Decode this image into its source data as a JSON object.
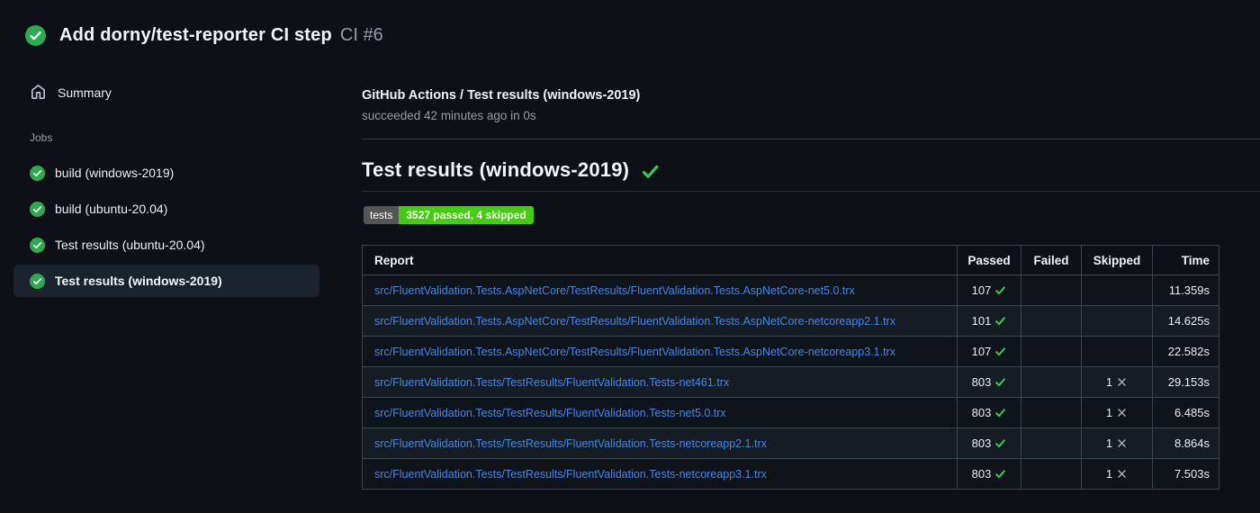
{
  "header": {
    "title": "Add dorny/test-reporter CI step",
    "run_number": "CI #6",
    "status": "success"
  },
  "sidebar": {
    "summary_label": "Summary",
    "jobs_label": "Jobs",
    "jobs": [
      {
        "label": "build (windows-2019)",
        "status": "success",
        "selected": false
      },
      {
        "label": "build (ubuntu-20.04)",
        "status": "success",
        "selected": false
      },
      {
        "label": "Test results (ubuntu-20.04)",
        "status": "success",
        "selected": false
      },
      {
        "label": "Test results (windows-2019)",
        "status": "success",
        "selected": true
      }
    ]
  },
  "main": {
    "breadcrumb": "GitHub Actions / Test results (windows-2019)",
    "status_line": "succeeded 42 minutes ago in 0s",
    "section_title": "Test results (windows-2019)",
    "badge": {
      "label": "tests",
      "value": "3527 passed, 4 skipped",
      "label_bg": "#555555",
      "value_bg": "#44cc11"
    },
    "table": {
      "columns": [
        "Report",
        "Passed",
        "Failed",
        "Skipped",
        "Time"
      ],
      "rows": [
        {
          "report": "src/FluentValidation.Tests.AspNetCore/TestResults/FluentValidation.Tests.AspNetCore-net5.0.trx",
          "passed": "107",
          "failed": "",
          "skipped": "",
          "time": "11.359s"
        },
        {
          "report": "src/FluentValidation.Tests.AspNetCore/TestResults/FluentValidation.Tests.AspNetCore-netcoreapp2.1.trx",
          "passed": "101",
          "failed": "",
          "skipped": "",
          "time": "14.625s"
        },
        {
          "report": "src/FluentValidation.Tests.AspNetCore/TestResults/FluentValidation.Tests.AspNetCore-netcoreapp3.1.trx",
          "passed": "107",
          "failed": "",
          "skipped": "",
          "time": "22.582s"
        },
        {
          "report": "src/FluentValidation.Tests/TestResults/FluentValidation.Tests-net461.trx",
          "passed": "803",
          "failed": "",
          "skipped": "1",
          "time": "29.153s"
        },
        {
          "report": "src/FluentValidation.Tests/TestResults/FluentValidation.Tests-net5.0.trx",
          "passed": "803",
          "failed": "",
          "skipped": "1",
          "time": "6.485s"
        },
        {
          "report": "src/FluentValidation.Tests/TestResults/FluentValidation.Tests-netcoreapp2.1.trx",
          "passed": "803",
          "failed": "",
          "skipped": "1",
          "time": "8.864s"
        },
        {
          "report": "src/FluentValidation.Tests/TestResults/FluentValidation.Tests-netcoreapp3.1.trx",
          "passed": "803",
          "failed": "",
          "skipped": "1",
          "time": "7.503s"
        }
      ]
    }
  },
  "colors": {
    "background": "#0d1117",
    "link": "#4486e2",
    "success_green": "#2ea44f",
    "check_green": "#2fd050",
    "skipped_gray": "#aab2ba"
  }
}
